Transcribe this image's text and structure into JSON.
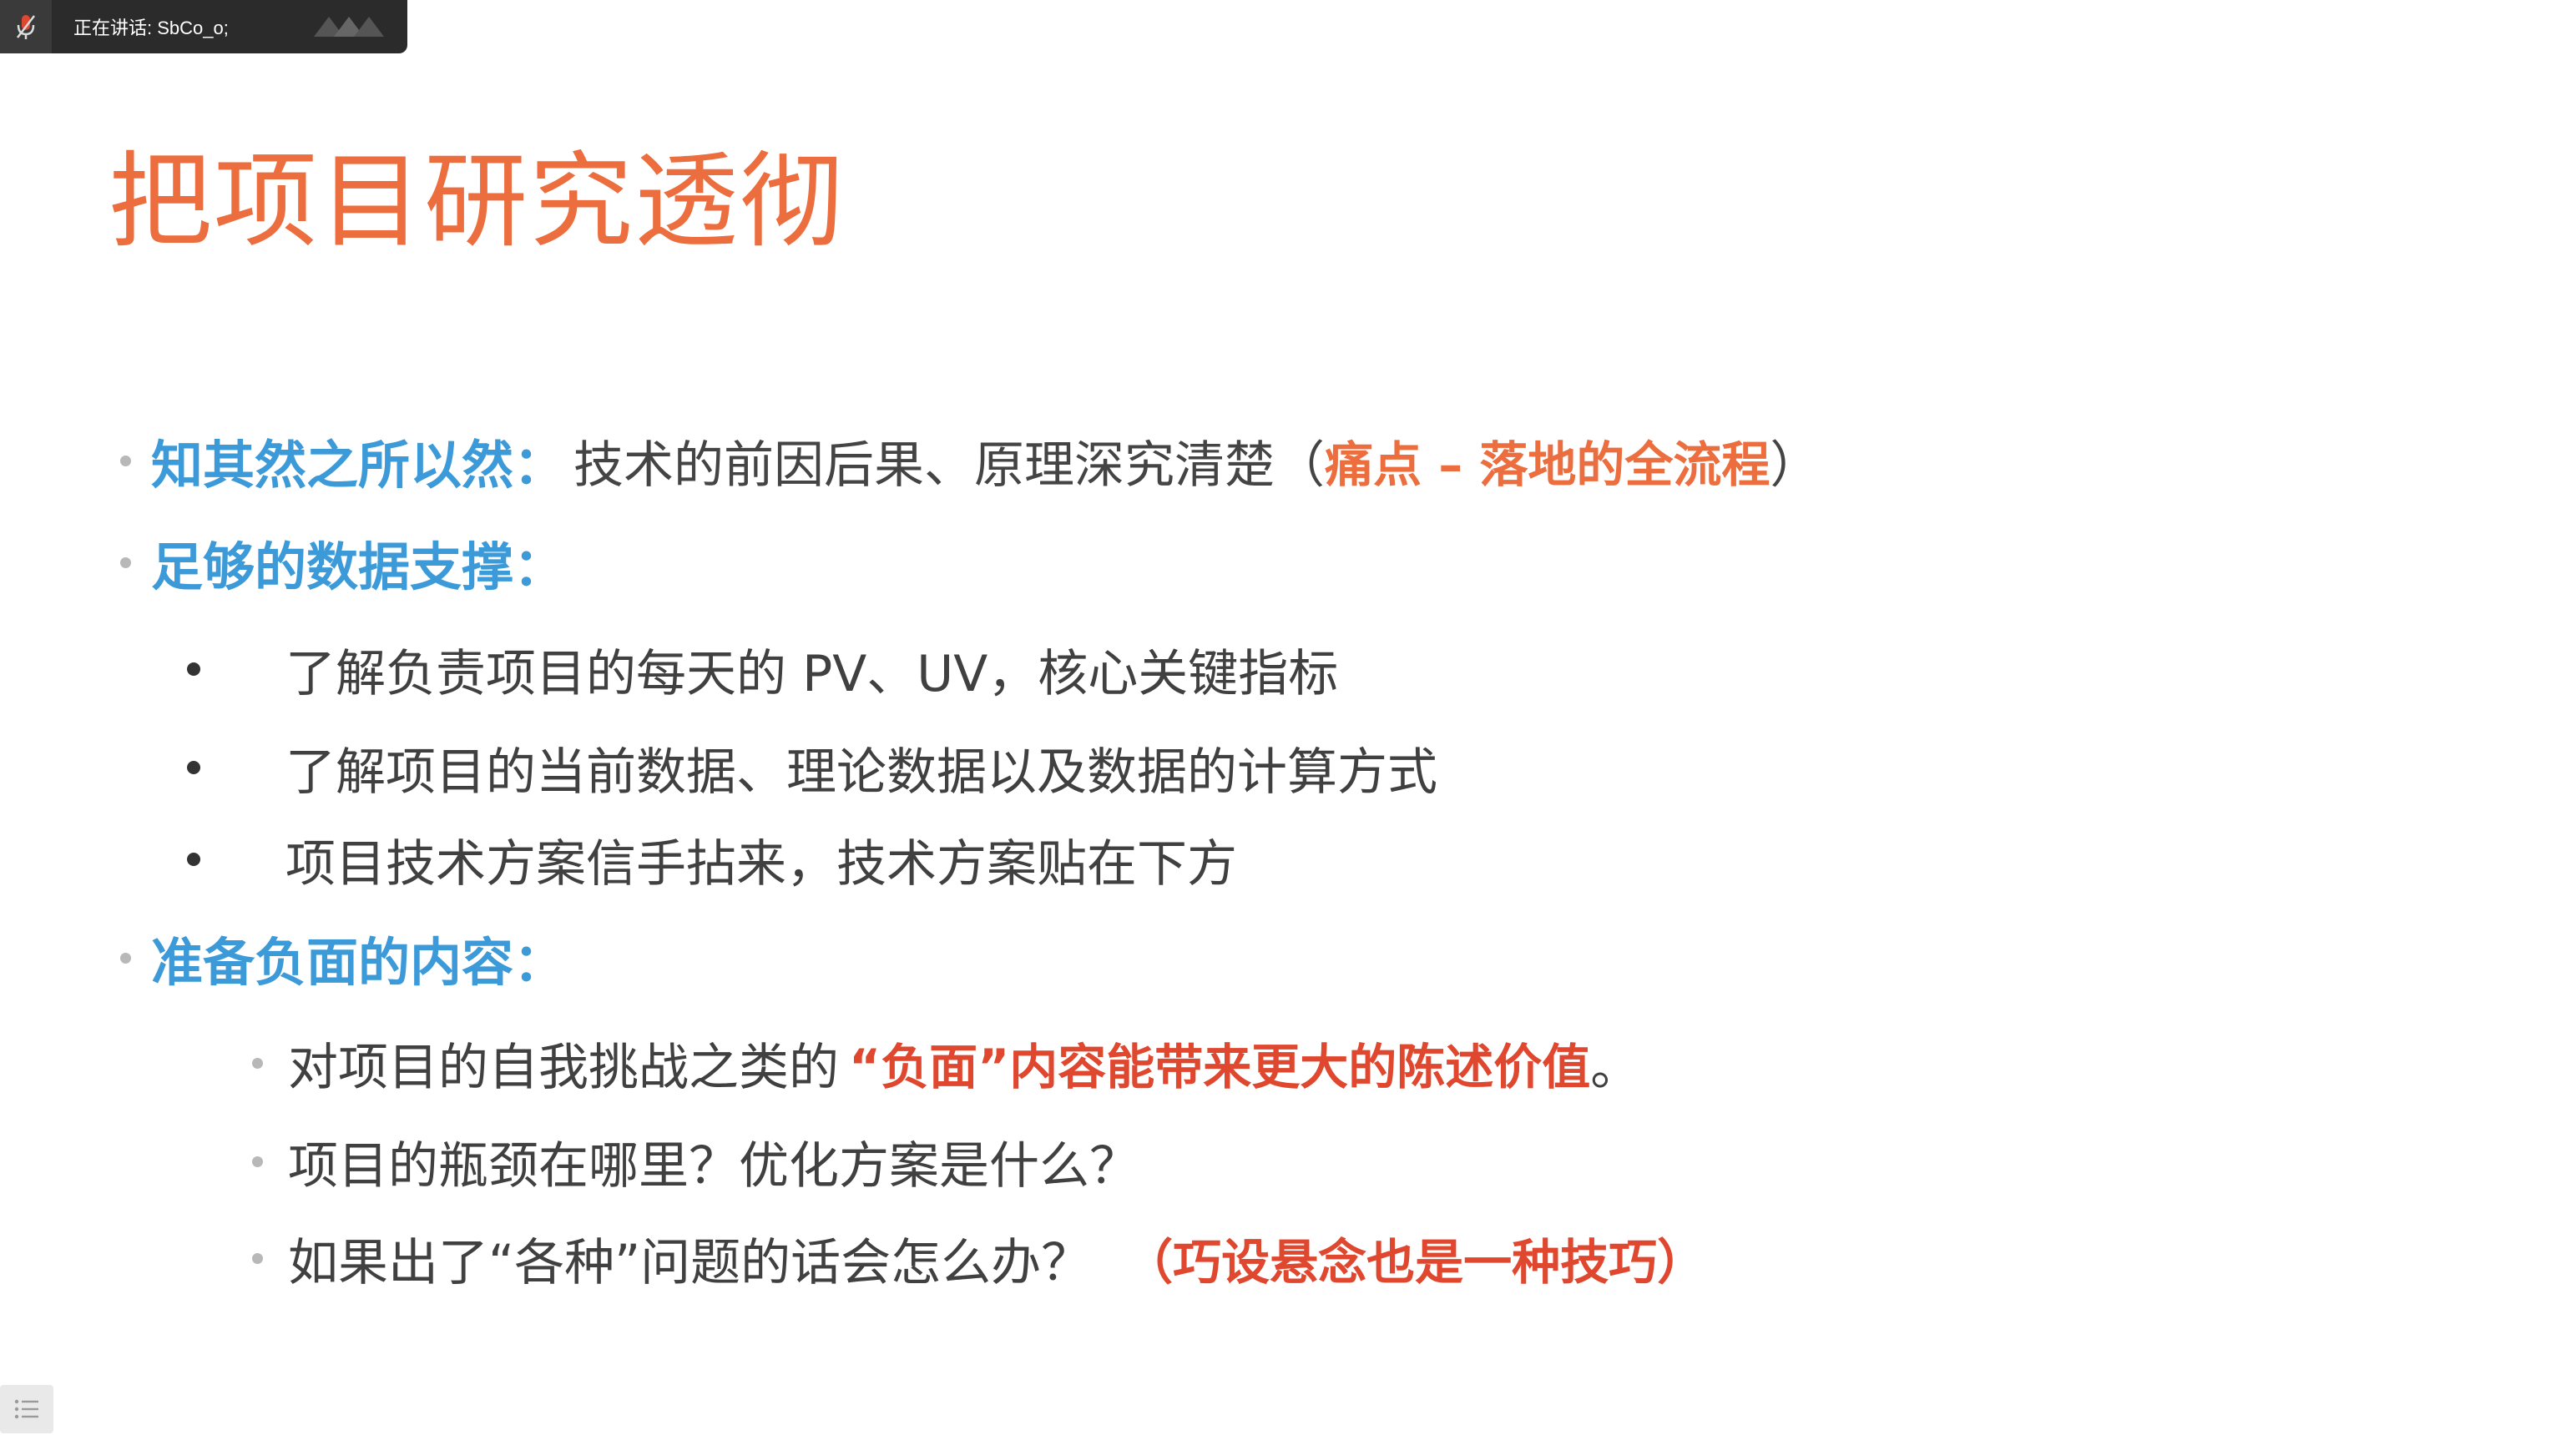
{
  "speaking": {
    "label": "正在讲话: SbCo_o;",
    "mic_icon": "mic-icon",
    "wave_icon": "sound-wave-icon"
  },
  "slide": {
    "title": "把项目研究透彻",
    "section1": {
      "heading": "知其然之所以然：",
      "text": "技术的前因后果、原理深究清楚（",
      "highlight": "痛点 – 落地的全流程",
      "close": "）"
    },
    "section2": {
      "heading": "足够的数据支撑：",
      "items": [
        "了解负责项目的每天的 PV、UV，核心关键指标",
        "了解项目的当前数据、理论数据以及数据的计算方式",
        "项目技术方案信手拈来，技术方案贴在下方"
      ]
    },
    "section3": {
      "heading": "准备负面的内容：",
      "item1": {
        "text": "对项目的自我挑战之类的",
        "highlight": "“负面”内容能带来更大的陈述价值",
        "end": "。"
      },
      "item2": "项目的瓶颈在哪里？优化方案是什么？",
      "item3": {
        "text": "如果出了“各种”问题的话会怎么办？",
        "highlight": "（巧设悬念也是一种技巧）"
      }
    }
  },
  "colors": {
    "title": "#ec6d3e",
    "heading_blue": "#3d9ad8",
    "highlight_orange": "#ec6d3e",
    "highlight_red": "#e0472f"
  },
  "toc_button": {
    "icon": "list-icon"
  }
}
